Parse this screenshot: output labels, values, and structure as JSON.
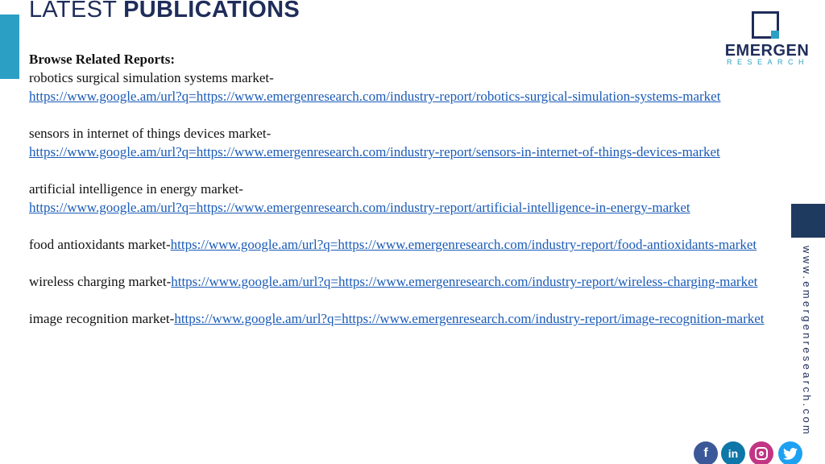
{
  "header": {
    "title_light": "LATEST ",
    "title_bold": "PUBLICATIONS"
  },
  "logo": {
    "word": "EMERGEN",
    "sub": "RESEARCH"
  },
  "content": {
    "heading": "Browse Related Reports:",
    "entries": [
      {
        "label": "robotics surgical simulation systems market-",
        "link": "https://www.google.am/url?q=https://www.emergenresearch.com/industry-report/robotics-surgical-simulation-systems-market"
      },
      {
        "label": "sensors in internet of things devices market-",
        "link": "https://www.google.am/url?q=https://www.emergenresearch.com/industry-report/sensors-in-internet-of-things-devices-market"
      },
      {
        "label": "artificial intelligence in energy market-",
        "link": "https://www.google.am/url?q=https://www.emergenresearch.com/industry-report/artificial-intelligence-in-energy-market"
      },
      {
        "label": "food antioxidants market-",
        "link": "https://www.google.am/url?q=https://www.emergenresearch.com/industry-report/food-antioxidants-market"
      },
      {
        "label": "wireless charging market-",
        "link": "https://www.google.am/url?q=https://www.emergenresearch.com/industry-report/wireless-charging-market"
      },
      {
        "label": "image recognition market-",
        "link": "https://www.google.am/url?q=https://www.emergenresearch.com/industry-report/image-recognition-market"
      }
    ]
  },
  "side": {
    "vertical_url": "www.emergenresearch.com"
  },
  "social": {
    "facebook_icon": "facebook-icon",
    "linkedin_icon": "linkedin-icon",
    "instagram_icon": "instagram-icon",
    "twitter_icon": "twitter-icon"
  },
  "colors": {
    "brand_navy": "#1f2d5a",
    "brand_teal": "#2ba0c4",
    "link_blue": "#1a5bb8"
  }
}
